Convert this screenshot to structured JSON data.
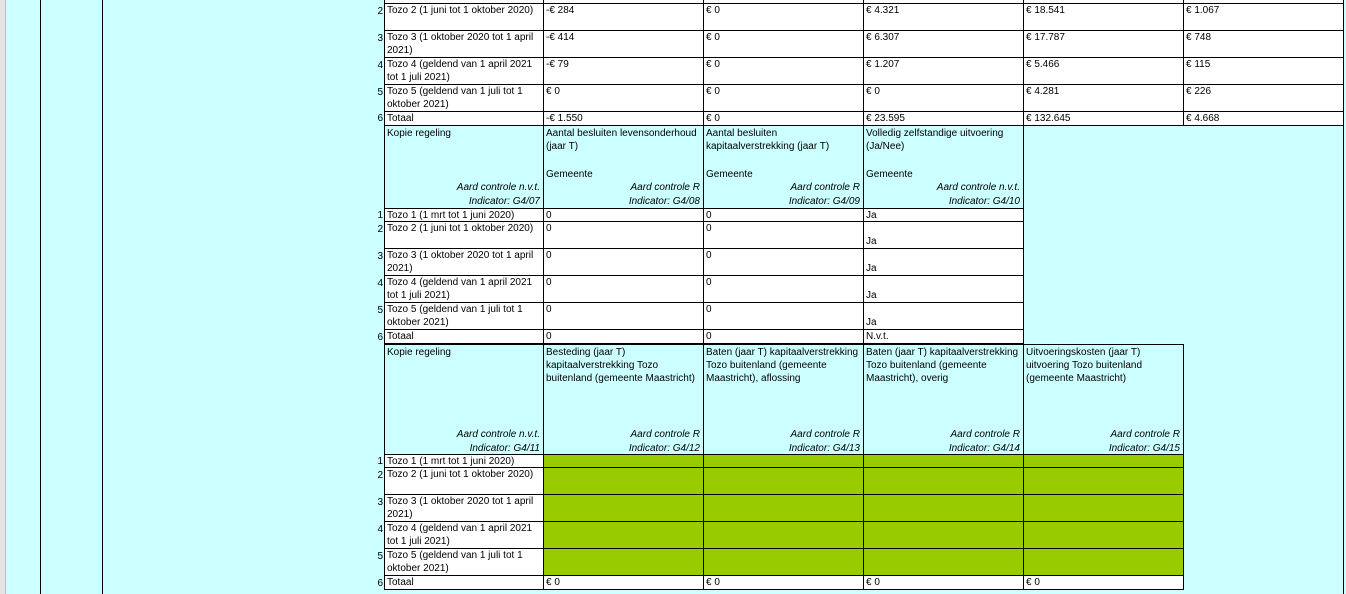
{
  "section1": {
    "rows": [
      {
        "num": "2",
        "label": "Tozo 2 (1 juni tot 1 oktober 2020)",
        "values": [
          "-€ 284",
          "€ 0",
          "€ 4.321",
          "€ 18.541",
          "€ 1.067"
        ]
      },
      {
        "num": "3",
        "label": "Tozo 3 (1 oktober 2020 tot 1 april 2021)",
        "values": [
          "-€ 414",
          "€ 0",
          "€ 6.307",
          "€ 17.787",
          "€ 748"
        ]
      },
      {
        "num": "4",
        "label": "Tozo 4 (geldend van 1 april 2021 tot 1 juli 2021)",
        "values": [
          "-€ 79",
          "€ 0",
          "€ 1.207",
          "€ 5.466",
          "€ 115"
        ]
      },
      {
        "num": "5",
        "label": "Tozo 5 (geldend van 1 juli tot 1 oktober 2021)",
        "values": [
          "€ 0",
          "€ 0",
          "€ 0",
          "€ 4.281",
          "€ 226"
        ]
      },
      {
        "num": "6",
        "label": "Totaal",
        "values": [
          "-€ 1.550",
          "€ 0",
          "€ 23.595",
          "€ 132.645",
          "€ 4.668"
        ]
      }
    ]
  },
  "section2": {
    "label_header": {
      "text": "Kopie regeling",
      "control": "Aard controle n.v.t.",
      "indicator": "Indicator: G4/07"
    },
    "headers": [
      {
        "text": "Aantal besluiten levensonderhoud (jaar T)",
        "sub": "Gemeente",
        "control": "Aard controle R",
        "indicator": "Indicator: G4/08"
      },
      {
        "text": "Aantal besluiten kapitaalverstrekking (jaar T)",
        "sub": "Gemeente",
        "control": "Aard controle R",
        "indicator": "Indicator: G4/09"
      },
      {
        "text": "Volledig zelfstandige uitvoering (Ja/Nee)",
        "sub": "Gemeente",
        "control": "Aard controle n.v.t.",
        "indicator": "Indicator: G4/10"
      }
    ],
    "rows": [
      {
        "num": "1",
        "label": "Tozo 1 (1 mrt tot 1 juni 2020)",
        "values": [
          "0",
          "0",
          "Ja"
        ]
      },
      {
        "num": "2",
        "label": "Tozo 2 (1 juni tot 1 oktober 2020)",
        "values": [
          "0",
          "0",
          "Ja"
        ]
      },
      {
        "num": "3",
        "label": "Tozo 3 (1 oktober 2020 tot 1 april 2021)",
        "values": [
          "0",
          "0",
          "Ja"
        ]
      },
      {
        "num": "4",
        "label": "Tozo 4 (geldend van 1 april 2021 tot 1 juli 2021)",
        "values": [
          "0",
          "0",
          "Ja"
        ]
      },
      {
        "num": "5",
        "label": "Tozo 5 (geldend van 1 juli tot 1 oktober 2021)",
        "values": [
          "0",
          "0",
          "Ja"
        ]
      },
      {
        "num": "6",
        "label": "Totaal",
        "values": [
          "0",
          "0",
          "N.v.t."
        ]
      }
    ]
  },
  "section3": {
    "label_header": {
      "text": "Kopie regeling",
      "control": "Aard controle n.v.t.",
      "indicator": "Indicator: G4/11"
    },
    "headers": [
      {
        "text": "Besteding (jaar T) kapitaalverstrekking Tozo buitenland (gemeente Maastricht)",
        "control": "Aard controle R",
        "indicator": "Indicator: G4/12"
      },
      {
        "text": "Baten (jaar T) kapitaalverstrekking Tozo buitenland (gemeente Maastricht), aflossing",
        "control": "Aard controle R",
        "indicator": "Indicator: G4/13"
      },
      {
        "text": "Baten (jaar T) kapitaalverstrekking Tozo buitenland (gemeente Maastricht), overig",
        "control": "Aard controle R",
        "indicator": "Indicator: G4/14"
      },
      {
        "text": "Uitvoeringskosten (jaar T) uitvoering Tozo buitenland (gemeente Maastricht)",
        "control": "Aard controle R",
        "indicator": "Indicator: G4/15"
      }
    ],
    "rows": [
      {
        "num": "1",
        "label": "Tozo 1 (1 mrt tot 1 juni 2020)"
      },
      {
        "num": "2",
        "label": "Tozo 2 (1 juni tot 1 oktober 2020)"
      },
      {
        "num": "3",
        "label": "Tozo 3 (1 oktober 2020 tot 1 april 2021)"
      },
      {
        "num": "4",
        "label": "Tozo 4 (geldend van 1 april 2021 tot 1 juli 2021)"
      },
      {
        "num": "5",
        "label": "Tozo 5 (geldend van 1 juli tot 1 oktober 2021)"
      }
    ],
    "total": {
      "num": "6",
      "label": "Totaal",
      "values": [
        "€ 0",
        "€ 0",
        "€ 0",
        "€ 0"
      ]
    }
  },
  "colors": {
    "background": "#ccffff",
    "input_green": "#99cc00",
    "cell": "#ffffff"
  }
}
